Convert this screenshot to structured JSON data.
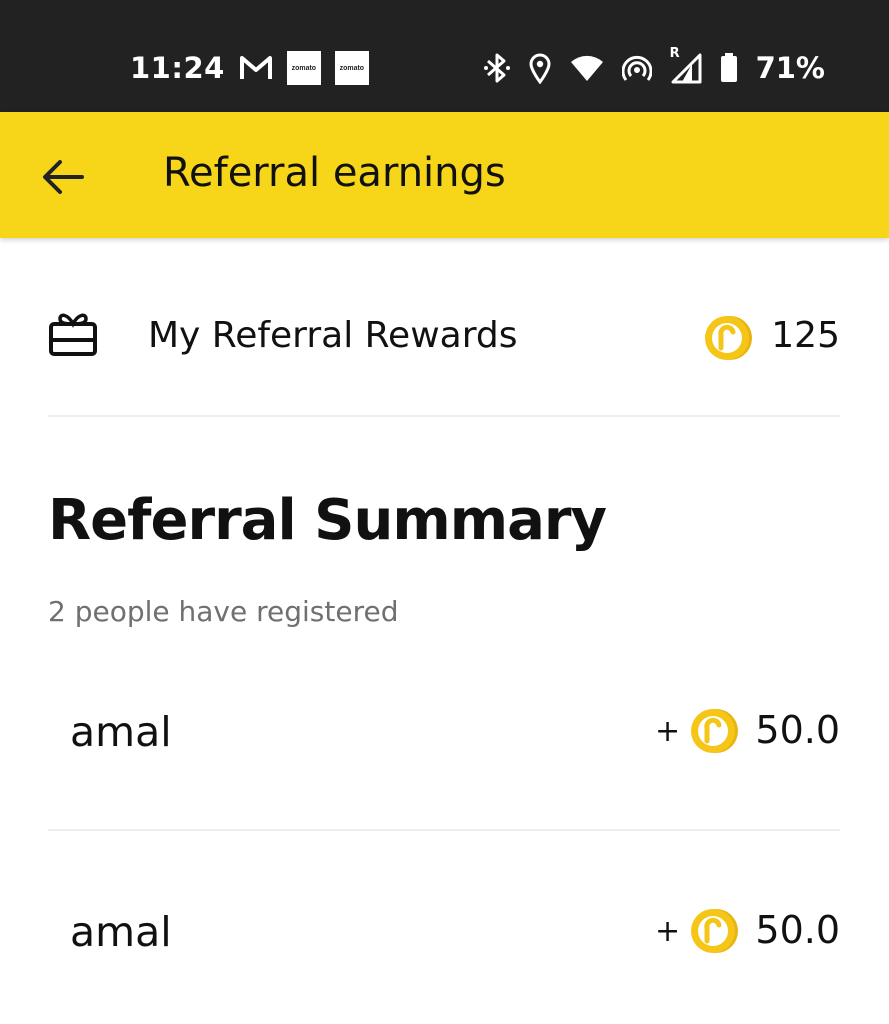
{
  "status_bar": {
    "time": "11:24",
    "logo_text": "zomato",
    "battery": "71%",
    "roaming_mark": "R"
  },
  "app_bar": {
    "title": "Referral earnings",
    "back_icon": "arrow-left-icon"
  },
  "rewards": {
    "label": "My Referral Rewards",
    "value": "125",
    "icon": "gift-card-icon",
    "coin_icon": "coin-icon"
  },
  "summary": {
    "title": "Referral Summary",
    "subtitle": "2 people have registered"
  },
  "referrals": [
    {
      "name": "amal",
      "sign": "+",
      "amount": "50.0"
    },
    {
      "name": "amal",
      "sign": "+",
      "amount": "50.0"
    }
  ],
  "colors": {
    "accent_yellow": "#f7d619",
    "coin_yellow": "#f5c518",
    "status_bar": "#222222",
    "muted_text": "#707070"
  }
}
